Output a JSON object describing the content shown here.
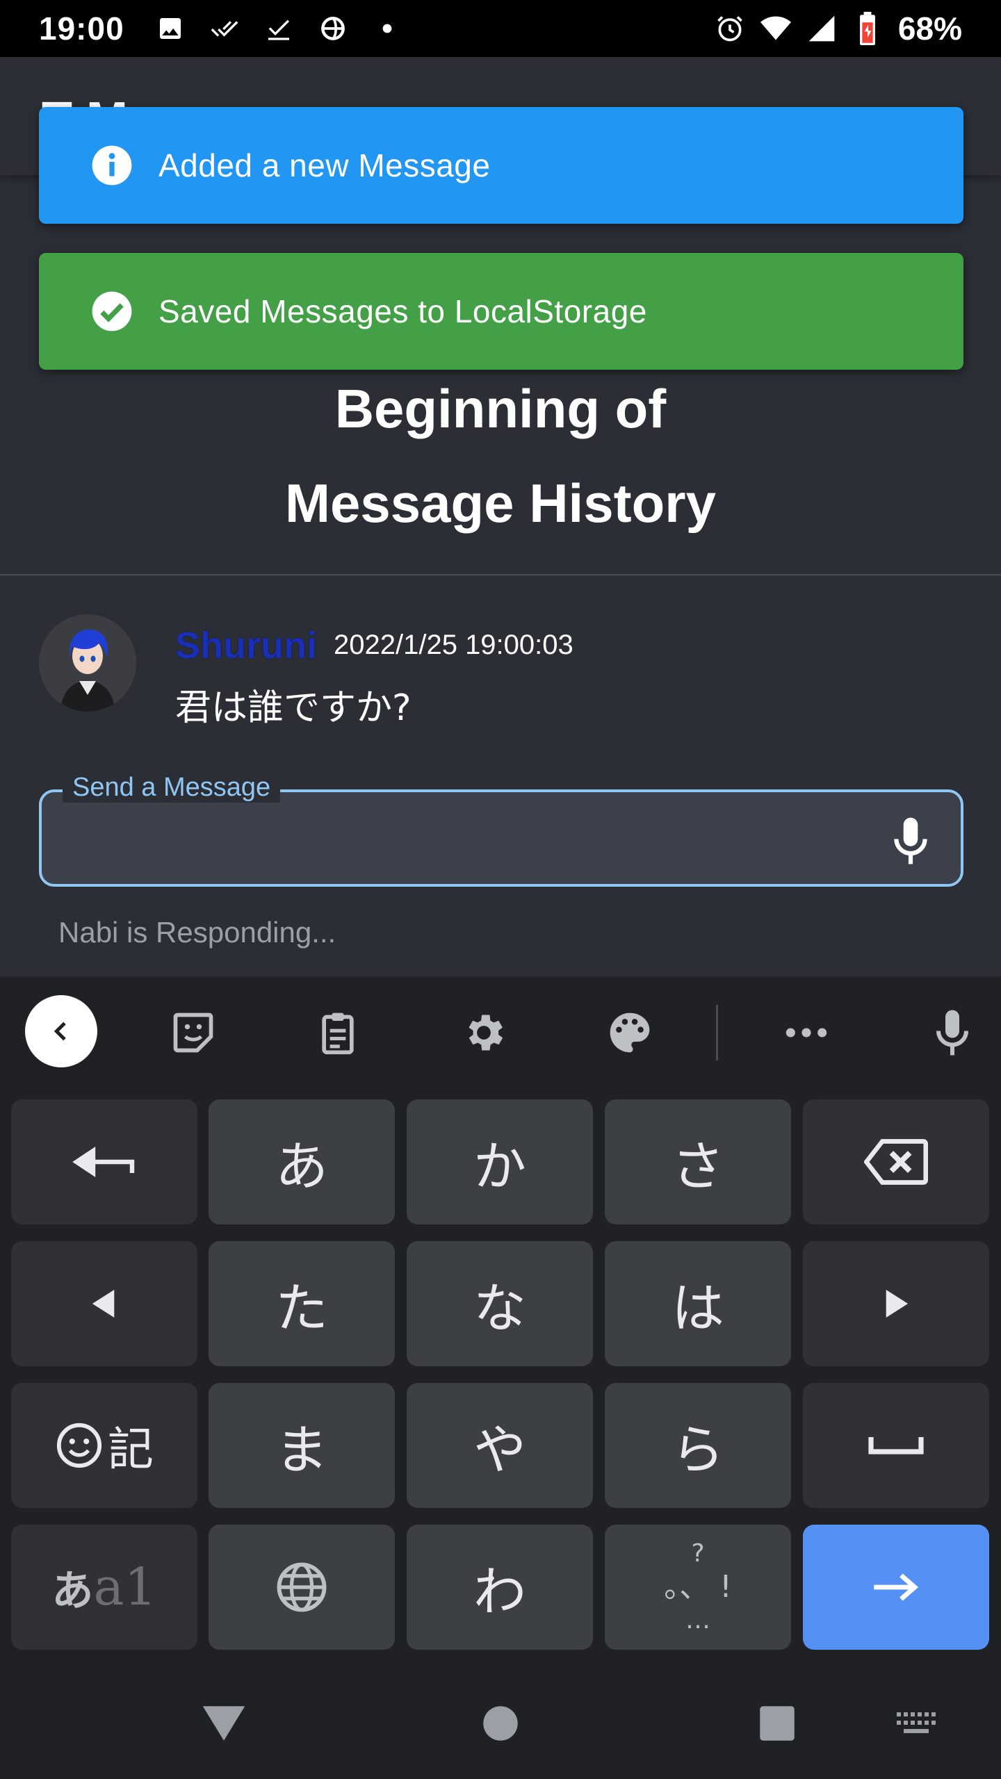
{
  "status_bar": {
    "time": "19:00",
    "battery_percent": "68%",
    "icons_left": [
      "image-icon",
      "double-check-icon",
      "check-icon",
      "sync-globe-icon",
      "dot-icon"
    ],
    "icons_right": [
      "alarm-icon",
      "wifi-icon",
      "signal-icon",
      "battery-icon"
    ]
  },
  "header": {
    "title": "T M"
  },
  "toasts": [
    {
      "type": "info",
      "text": "Added a new Message",
      "color": "#2196f3"
    },
    {
      "type": "success",
      "text": "Saved Messages to LocalStorage",
      "color": "#43a047"
    }
  ],
  "history": {
    "title_line1": "Beginning of",
    "title_line2": "Message History"
  },
  "message": {
    "user": "Shuruni",
    "timestamp": "2022/1/25 19:00:03",
    "body": "君は誰ですか?"
  },
  "input": {
    "label": "Send a Message",
    "value": ""
  },
  "status": {
    "responding": "Nabi is Responding..."
  },
  "keyboard": {
    "rows": [
      [
        "undo",
        "あ",
        "か",
        "さ",
        "backspace"
      ],
      [
        "left",
        "た",
        "な",
        "は",
        "right"
      ],
      [
        "emoji-kigou",
        "ま",
        "や",
        "ら",
        "space"
      ],
      [
        "mode",
        "globe",
        "わ",
        "punct",
        "enter"
      ]
    ],
    "labels": {
      "a": "あ",
      "ka": "か",
      "sa": "さ",
      "ta": "た",
      "na": "な",
      "ha": "は",
      "ma": "ま",
      "ya": "や",
      "ra": "ら",
      "wa": "わ",
      "kigou": "記",
      "mode_kana": "あ",
      "mode_latin": "a1",
      "punct_top": "?",
      "punct_mid": "。、 !",
      "punct_bottom": "…"
    }
  },
  "colors": {
    "accent": "#90c6f4",
    "enter_key": "#5590f4",
    "background": "#2b2e35"
  }
}
